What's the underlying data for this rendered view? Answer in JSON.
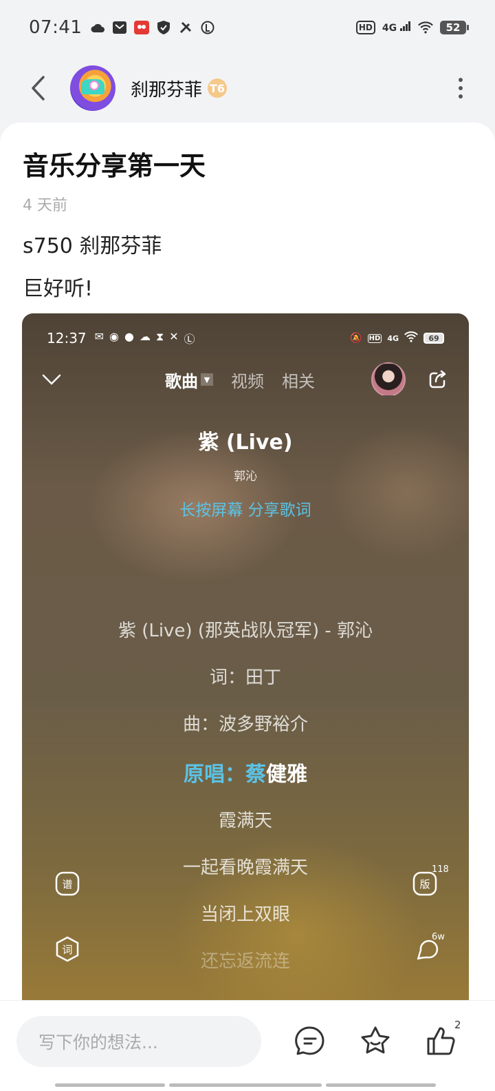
{
  "status_bar": {
    "time": "07:41",
    "hd": "HD",
    "network": "4G",
    "battery": "52"
  },
  "header": {
    "username": "刹那芬菲",
    "level_badge": "T6"
  },
  "post": {
    "title": "音乐分享第一天",
    "time_ago": "4 天前",
    "line1": "s750  刹那芬菲",
    "line2": "巨好听!"
  },
  "embed": {
    "status_time": "12:37",
    "hd": "HD",
    "network": "4G",
    "battery": "69",
    "tabs": [
      {
        "label": "歌曲",
        "active": true
      },
      {
        "label": "视频",
        "active": false
      },
      {
        "label": "相关",
        "active": false
      }
    ],
    "song_title": "紫 (Live)",
    "artist": "郭沁",
    "share_hint": "长按屏幕 分享歌词",
    "lyrics": [
      {
        "text": "紫 (Live) (那英战队冠军) - 郭沁",
        "state": "normal"
      },
      {
        "text": "词：田丁",
        "state": "normal"
      },
      {
        "text": "曲：波多野裕介",
        "state": "normal"
      },
      {
        "text_highlight": "原唱：蔡",
        "text_rest": "健雅",
        "state": "current"
      },
      {
        "text": "霞满天",
        "state": "normal"
      },
      {
        "text": "一起看晚霞满天",
        "state": "normal"
      },
      {
        "text": "当闭上双眼",
        "state": "normal"
      },
      {
        "text": "还忘返流连",
        "state": "fade"
      }
    ],
    "side_left": [
      {
        "icon": "score-icon",
        "label": "谱"
      },
      {
        "icon": "lyrics-icon",
        "label": "词"
      }
    ],
    "side_right": [
      {
        "icon": "version-icon",
        "label": "版",
        "count": "118"
      },
      {
        "icon": "comment-icon",
        "count": "6w"
      }
    ]
  },
  "bottom_bar": {
    "input_placeholder": "写下你的想法...",
    "like_count": "2"
  }
}
